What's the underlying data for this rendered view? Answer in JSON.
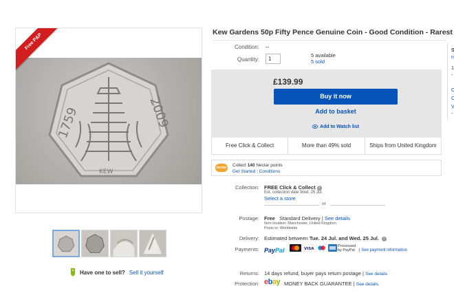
{
  "item": {
    "title": "Kew Gardens 50p Fifty Pence Genuine Coin - Good Condition - Rarest Coin",
    "ribbon": "Free P&P"
  },
  "details": {
    "condition_label": "Condition:",
    "condition_value": "--",
    "quantity_label": "Quantity:",
    "quantity_value": "1",
    "available": "5 available",
    "sold": "5 sold"
  },
  "buy": {
    "price": "£139.99",
    "buy_now": "Buy it now",
    "add_basket": "Add to basket",
    "watch": "Add to Watch list"
  },
  "features": [
    "Free Click & Collect",
    "More than 49% sold",
    "Ships from United Kingdom"
  ],
  "nectar": {
    "logo": "nectar",
    "text_prefix": "Collect",
    "points": "140",
    "text_suffix": "Nectar points",
    "link_started": "Get Started",
    "link_sep": "|",
    "link_conditions": "Conditions"
  },
  "collection": {
    "label": "Collection:",
    "title": "FREE Click & Collect",
    "est": "Est. collection date Wed. 25 Jul.",
    "link": "Select a store",
    "or": "or"
  },
  "postage": {
    "label": "Postage:",
    "free": "Free",
    "method": "Standard Delivery",
    "sep": "|",
    "link": "See details",
    "location": "Item location: Manchester, United Kingdom",
    "posts_to": "Posts to: Worldwide"
  },
  "delivery": {
    "label": "Delivery:",
    "prefix": "Estimated between",
    "dates": "Tue. 24 Jul. and Wed. 25 Jul.",
    "info": "i"
  },
  "payments": {
    "label": "Payments:",
    "paypal_1": "Pay",
    "paypal_2": "Pal",
    "processed": "Processed",
    "by_paypal": "by PayPal",
    "sep": "|",
    "link": "See payment information"
  },
  "returns": {
    "label": "Returns:",
    "text": "14 days refund, buyer pays return postage",
    "sep": "|",
    "link": "See details"
  },
  "protection": {
    "label": "Protection:",
    "ebay_e": "e",
    "ebay_b": "b",
    "ebay_a": "a",
    "ebay_y": "y",
    "guarantee": "MONEY BACK GUARANTEE",
    "sep": "|",
    "link": "See details"
  },
  "sell": {
    "label": "Have one to sell?",
    "link": "Sell it yourself"
  },
  "side_panel": [
    "S",
    "n",
    "1",
    "-",
    "C",
    "C",
    "V",
    "-"
  ],
  "colors": {
    "accent_blue": "#0654ba",
    "ribbon_red": "#d11d1d",
    "buy_box_grey": "#e6e6e6",
    "paypal_dark": "#003087",
    "paypal_light": "#009cde"
  }
}
